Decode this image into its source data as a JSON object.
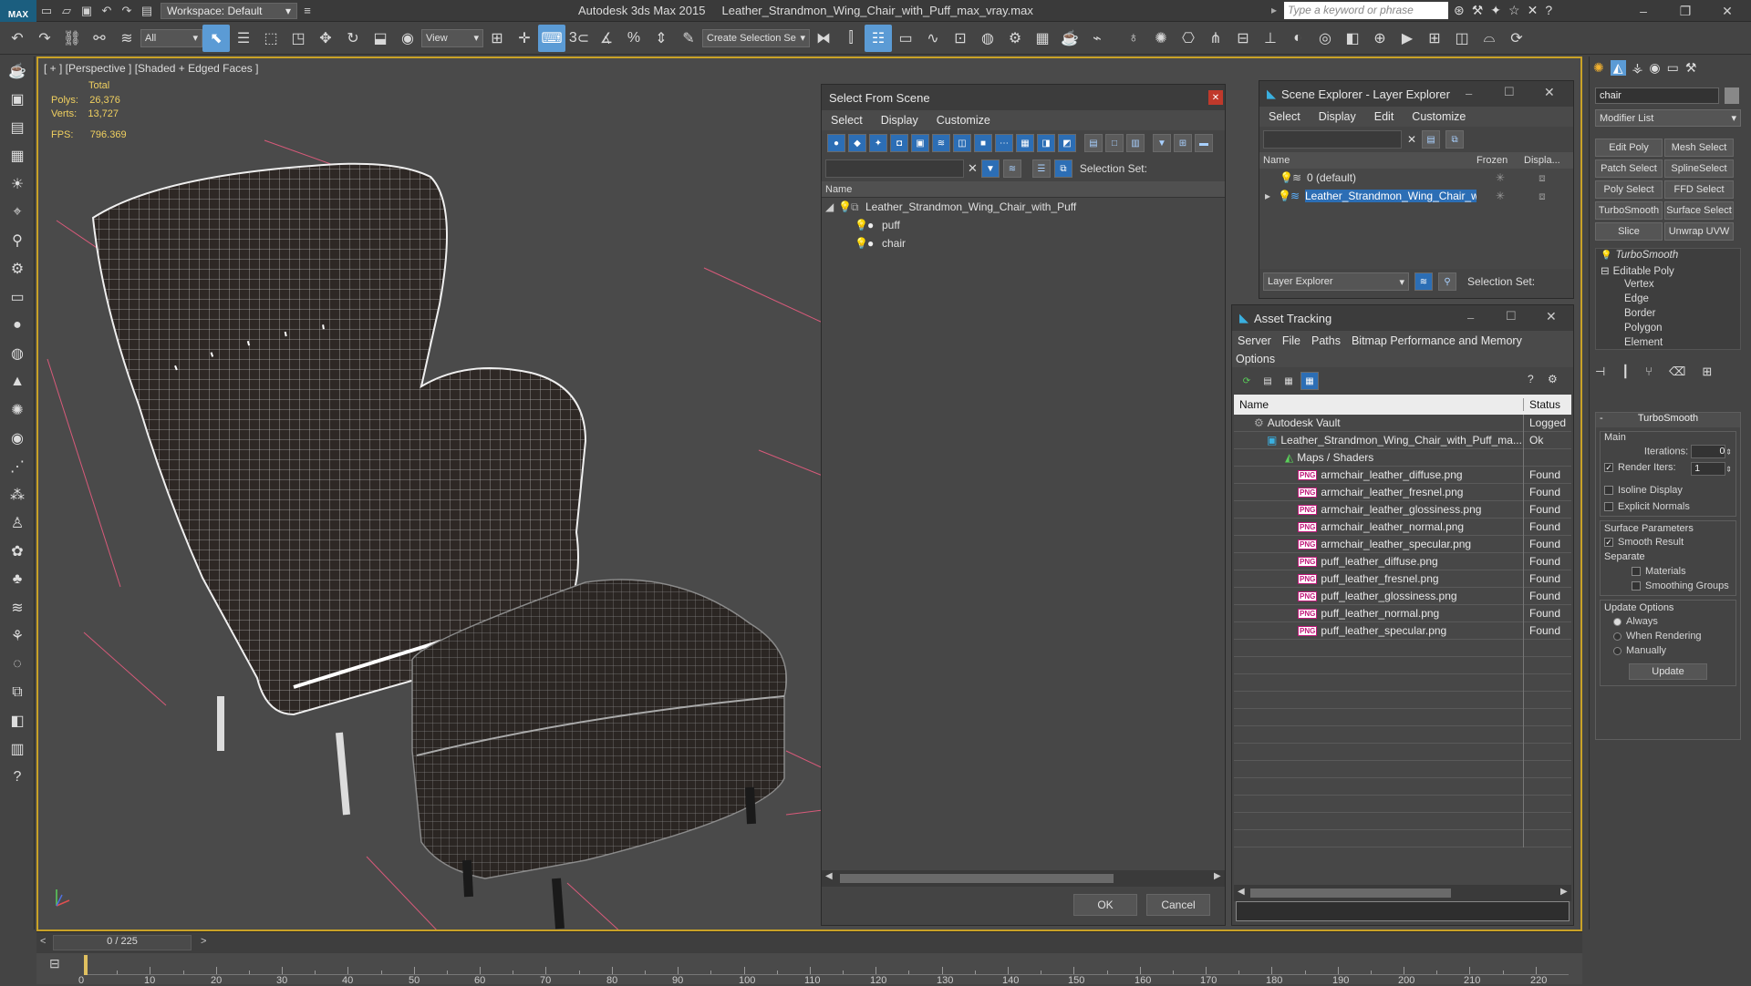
{
  "titlebar": {
    "workspace_label": "Workspace: Default",
    "app_name": "Autodesk 3ds Max  2015",
    "file_name": "Leather_Strandmon_Wing_Chair_with_Puff_max_vray.max",
    "search_placeholder": "Type a keyword or phrase"
  },
  "toolbar": {
    "filter_value": "All",
    "view_value": "View",
    "create_selection_value": "Create Selection Se",
    "snap_label": "3"
  },
  "viewport": {
    "label": "[ + ] [Perspective ] [Shaded + Edged Faces ]",
    "total_label": "Total",
    "polys_label": "Polys:",
    "polys_value": "26,376",
    "verts_label": "Verts:",
    "verts_value": "13,727",
    "fps_label": "FPS:",
    "fps_value": "796.369"
  },
  "select_from_scene": {
    "title": "Select From Scene",
    "menu": [
      "Select",
      "Display",
      "Customize"
    ],
    "selection_set_label": "Selection Set:",
    "column_name": "Name",
    "tree": {
      "root": "Leather_Strandmon_Wing_Chair_with_Puff",
      "children": [
        "puff",
        "chair"
      ]
    },
    "ok": "OK",
    "cancel": "Cancel"
  },
  "scene_explorer": {
    "title": "Scene Explorer - Layer Explorer",
    "menu": [
      "Select",
      "Display",
      "Edit",
      "Customize"
    ],
    "col_name": "Name",
    "col_frozen": "Frozen",
    "col_display": "Displa...",
    "rows": [
      "0 (default)",
      "Leather_Strandmon_Wing_Chair_wi..."
    ],
    "footer_dropdown": "Layer Explorer",
    "selection_set_label": "Selection Set:"
  },
  "asset_tracking": {
    "title": "Asset Tracking",
    "menu": [
      "Server",
      "File",
      "Paths",
      "Bitmap Performance and Memory"
    ],
    "menu2": "Options",
    "col_name": "Name",
    "col_status": "Status",
    "vault": {
      "name": "Autodesk Vault",
      "status": "Logged"
    },
    "file": {
      "name": "Leather_Strandmon_Wing_Chair_with_Puff_ma...",
      "status": "Ok"
    },
    "group": "Maps / Shaders",
    "maps": [
      {
        "name": "armchair_leather_diffuse.png",
        "status": "Found"
      },
      {
        "name": "armchair_leather_fresnel.png",
        "status": "Found"
      },
      {
        "name": "armchair_leather_glossiness.png",
        "status": "Found"
      },
      {
        "name": "armchair_leather_normal.png",
        "status": "Found"
      },
      {
        "name": "armchair_leather_specular.png",
        "status": "Found"
      },
      {
        "name": "puff_leather_diffuse.png",
        "status": "Found"
      },
      {
        "name": "puff_leather_fresnel.png",
        "status": "Found"
      },
      {
        "name": "puff_leather_glossiness.png",
        "status": "Found"
      },
      {
        "name": "puff_leather_normal.png",
        "status": "Found"
      },
      {
        "name": "puff_leather_specular.png",
        "status": "Found"
      }
    ]
  },
  "command_panel": {
    "object_name": "chair",
    "modifier_list": "Modifier List",
    "buttons": [
      "Edit Poly",
      "Mesh Select",
      "Patch Select",
      "SplineSelect",
      "Poly Select",
      "FFD Select",
      "TurboSmooth",
      "Surface Select",
      "Slice",
      "Unwrap UVW"
    ],
    "stack": {
      "turbosmooth": "TurboSmooth",
      "editable_poly": "Editable Poly",
      "subobjects": [
        "Vertex",
        "Edge",
        "Border",
        "Polygon",
        "Element"
      ]
    },
    "turbosmooth_rollout": {
      "title": "TurboSmooth",
      "main": "Main",
      "iterations_label": "Iterations:",
      "iterations_value": "0",
      "render_iters_label": "Render Iters:",
      "render_iters_value": "1",
      "isoline": "Isoline Display",
      "explicit_normals": "Explicit Normals",
      "surface_params": "Surface Parameters",
      "smooth_result": "Smooth Result",
      "separate": "Separate",
      "materials": "Materials",
      "smoothing_groups": "Smoothing Groups",
      "update_options": "Update Options",
      "always": "Always",
      "when_rendering": "When Rendering",
      "manually": "Manually",
      "update": "Update"
    }
  },
  "timeline": {
    "frame_label": "0 / 225",
    "ticks": [
      "0",
      "10",
      "20",
      "30",
      "40",
      "50",
      "60",
      "70",
      "80",
      "90",
      "100",
      "110",
      "120",
      "130",
      "140",
      "150",
      "160",
      "170",
      "180",
      "190",
      "200",
      "210",
      "220"
    ]
  }
}
